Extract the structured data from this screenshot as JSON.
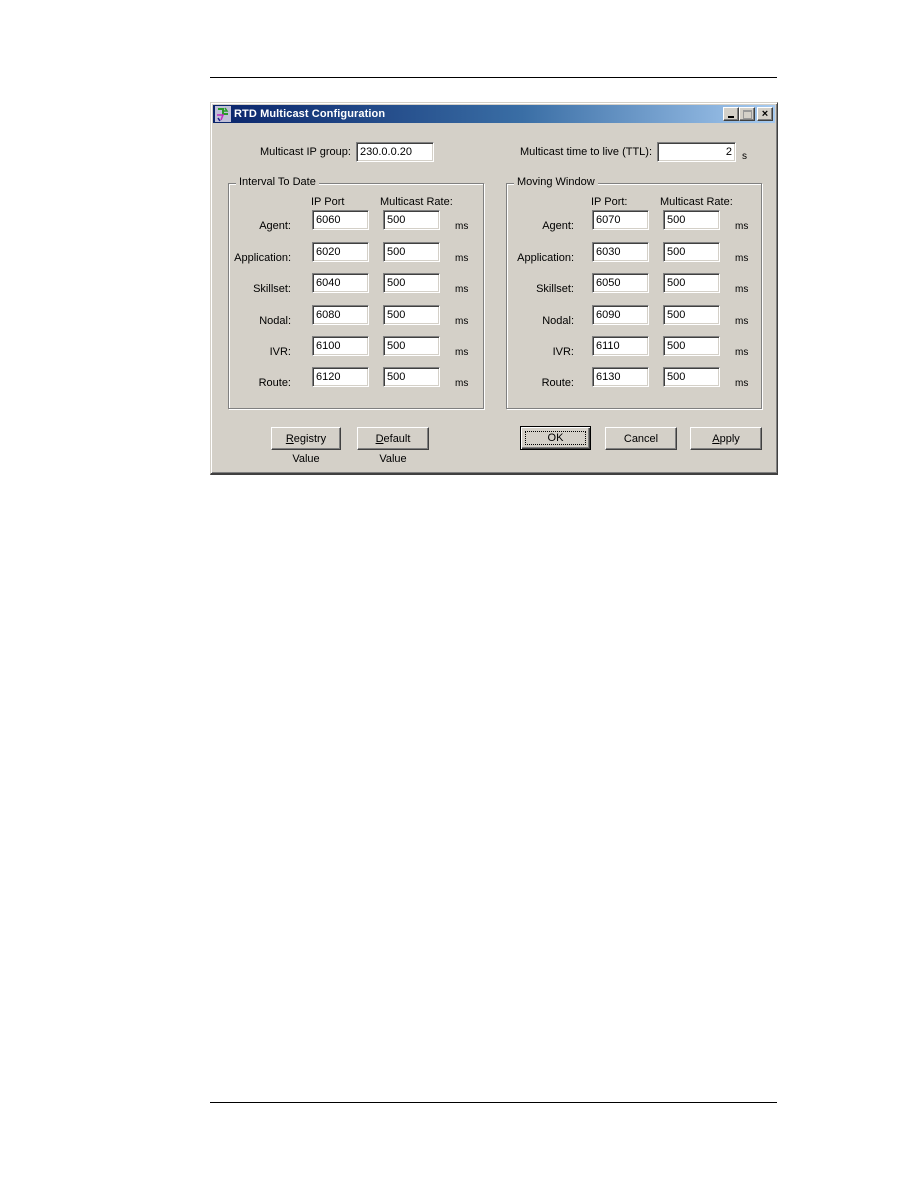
{
  "window": {
    "title": "RTD Multicast Configuration",
    "controls": {
      "minimize": "minimize",
      "maximize": "maximize",
      "close": "×"
    }
  },
  "top": {
    "ip_group_label": "Multicast IP group:",
    "ip_group_value": "230.0.0.20",
    "ttl_label": "Multicast time to live (TTL):",
    "ttl_value": "2",
    "ttl_unit": "s"
  },
  "interval_to_date": {
    "title": "Interval To Date",
    "col_port": "IP Port",
    "col_rate": "Multicast Rate:",
    "unit": "ms",
    "rows": [
      {
        "label": "Agent:",
        "port": "6060",
        "rate": "500"
      },
      {
        "label": "Application:",
        "port": "6020",
        "rate": "500"
      },
      {
        "label": "Skillset:",
        "port": "6040",
        "rate": "500"
      },
      {
        "label": "Nodal:",
        "port": "6080",
        "rate": "500"
      },
      {
        "label": "IVR:",
        "port": "6100",
        "rate": "500"
      },
      {
        "label": "Route:",
        "port": "6120",
        "rate": "500"
      }
    ]
  },
  "moving_window": {
    "title": "Moving Window",
    "col_port": "IP Port:",
    "col_rate": "Multicast Rate:",
    "unit": "ms",
    "rows": [
      {
        "label": "Agent:",
        "port": "6070",
        "rate": "500"
      },
      {
        "label": "Application:",
        "port": "6030",
        "rate": "500"
      },
      {
        "label": "Skillset:",
        "port": "6050",
        "rate": "500"
      },
      {
        "label": "Nodal:",
        "port": "6090",
        "rate": "500"
      },
      {
        "label": "IVR:",
        "port": "6110",
        "rate": "500"
      },
      {
        "label": "Route:",
        "port": "6130",
        "rate": "500"
      }
    ]
  },
  "buttons": {
    "registry": {
      "accel": "R",
      "rest": "egistry Value"
    },
    "default": {
      "accel": "D",
      "rest": "efault Value"
    },
    "ok": "OK",
    "cancel": "Cancel",
    "apply": {
      "accel": "A",
      "rest": "pply"
    }
  }
}
